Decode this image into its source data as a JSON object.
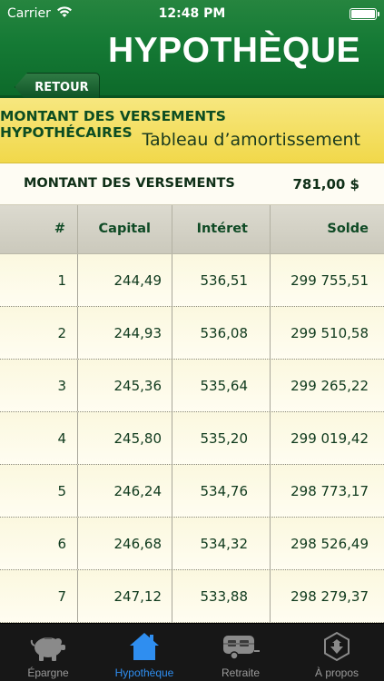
{
  "status_bar": {
    "carrier": "Carrier",
    "time": "12:48 PM"
  },
  "nav": {
    "back_label": "RETOUR",
    "title": "HYPOTHÈQUE"
  },
  "section": {
    "title": "MONTANT DES VERSEMENTS HYPOTHÉCAIRES",
    "subtitle": "Tableau d’amortissement"
  },
  "summary": {
    "label": "MONTANT DES VERSEMENTS",
    "value": "781,00 $"
  },
  "table": {
    "headers": [
      "#",
      "Capital",
      "Intéret",
      "Solde"
    ],
    "rows": [
      {
        "n": "1",
        "capital": "244,49",
        "interet": "536,51",
        "solde": "299 755,51"
      },
      {
        "n": "2",
        "capital": "244,93",
        "interet": "536,08",
        "solde": "299 510,58"
      },
      {
        "n": "3",
        "capital": "245,36",
        "interet": "535,64",
        "solde": "299 265,22"
      },
      {
        "n": "4",
        "capital": "245,80",
        "interet": "535,20",
        "solde": "299 019,42"
      },
      {
        "n": "5",
        "capital": "246,24",
        "interet": "534,76",
        "solde": "298 773,17"
      },
      {
        "n": "6",
        "capital": "246,68",
        "interet": "534,32",
        "solde": "298 526,49"
      },
      {
        "n": "7",
        "capital": "247,12",
        "interet": "533,88",
        "solde": "298 279,37"
      }
    ]
  },
  "tabs": [
    {
      "label": "Épargne",
      "icon": "piggy-bank-icon",
      "active": false
    },
    {
      "label": "Hypothèque",
      "icon": "house-icon",
      "active": true
    },
    {
      "label": "Retraite",
      "icon": "camper-trailer-icon",
      "active": false
    },
    {
      "label": "À propos",
      "icon": "info-badge-icon",
      "active": false
    }
  ],
  "colors": {
    "header_green": "#157a35",
    "band_yellow": "#f1d84a",
    "accent_blue": "#2f8ef0"
  }
}
